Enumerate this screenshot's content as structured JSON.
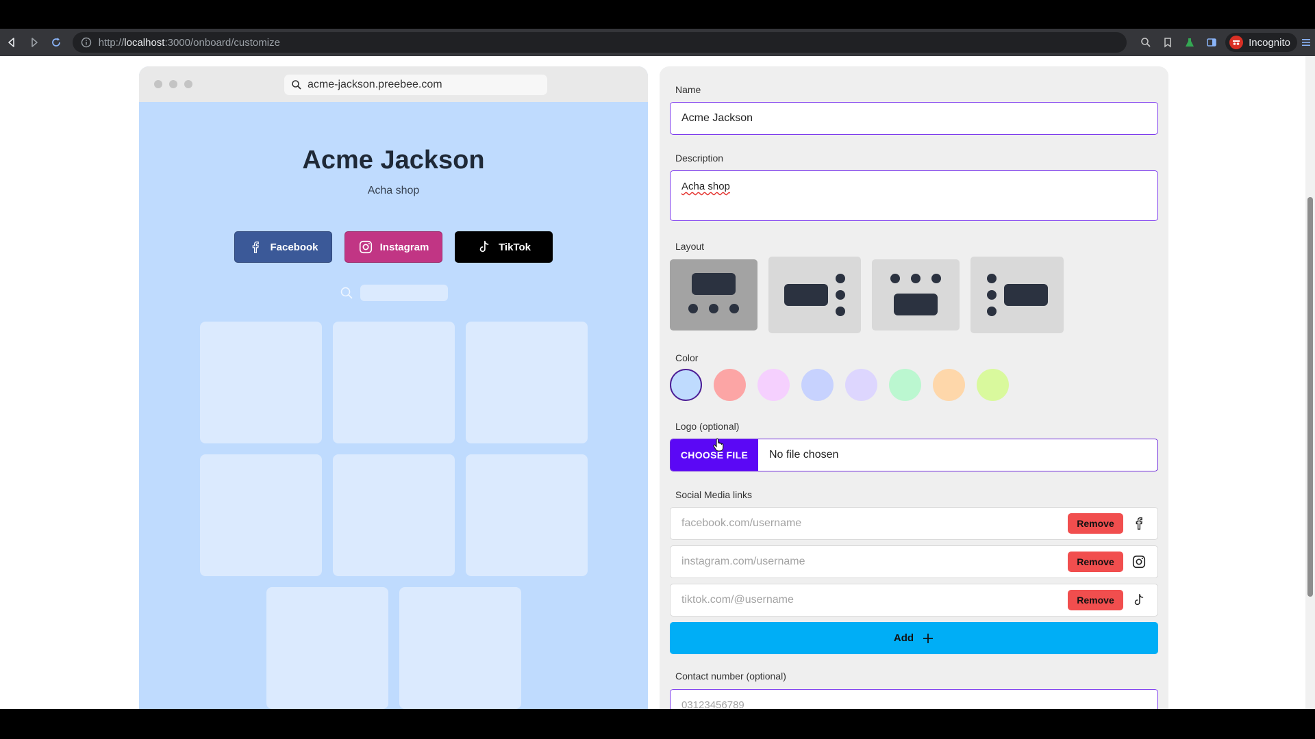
{
  "browser": {
    "url_prefix": "http://",
    "url_host": "localhost",
    "url_path": ":3000/onboard/customize",
    "incognito_label": "Incognito"
  },
  "preview": {
    "address": "acme-jackson.preebee.com",
    "title": "Acme Jackson",
    "description": "Acha shop",
    "social_buttons": [
      {
        "label": "Facebook",
        "icon": "facebook-icon",
        "color": "#3b5998"
      },
      {
        "label": "Instagram",
        "icon": "instagram-icon",
        "color": "#c13584"
      },
      {
        "label": "TikTok",
        "icon": "tiktok-icon",
        "color": "#000000"
      }
    ],
    "background_color": "#bfdbfe"
  },
  "form": {
    "name_label": "Name",
    "name_value": "Acme Jackson",
    "description_label": "Description",
    "description_value": "Acha shop",
    "layout_label": "Layout",
    "layout_selected_index": 0,
    "color_label": "Color",
    "colors": [
      "#bfdbfe",
      "#fca5a5",
      "#f5d0fe",
      "#c7d2fe",
      "#ddd6fe",
      "#bbf7d0",
      "#fed7aa",
      "#d9f99d"
    ],
    "color_selected_index": 0,
    "logo_label": "Logo (optional)",
    "choose_file_label": "CHOOSE FILE",
    "no_file_text": "No file chosen",
    "social_label": "Social Media links",
    "social_links": [
      {
        "placeholder": "facebook.com/username",
        "remove_label": "Remove",
        "icon": "facebook-icon"
      },
      {
        "placeholder": "instagram.com/username",
        "remove_label": "Remove",
        "icon": "instagram-icon"
      },
      {
        "placeholder": "tiktok.com/@username",
        "remove_label": "Remove",
        "icon": "tiktok-icon"
      }
    ],
    "add_label": "Add",
    "contact_label": "Contact number (optional)",
    "contact_placeholder": "03123456789"
  }
}
